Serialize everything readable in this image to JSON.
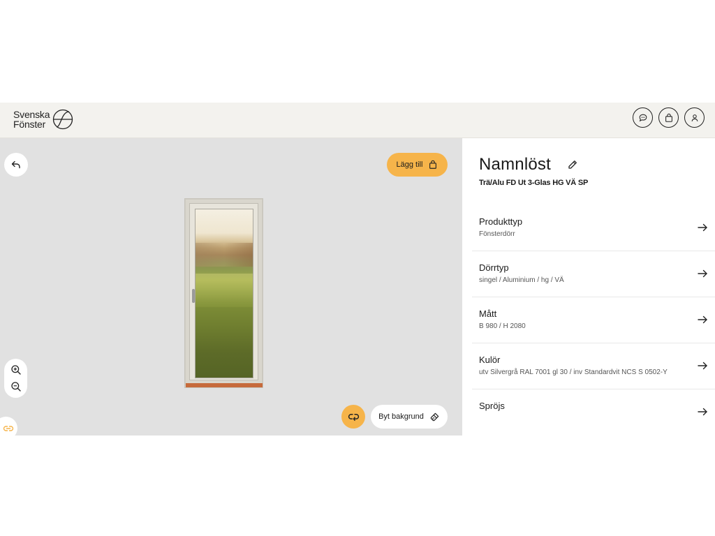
{
  "header": {
    "brand_line1": "Svenska",
    "brand_line2": "Fönster",
    "actions": [
      {
        "icon": "chat-icon"
      },
      {
        "icon": "bag-icon"
      },
      {
        "icon": "user-icon"
      }
    ]
  },
  "canvas": {
    "add_label": "Lägg till",
    "background_label": "Byt bakgrund",
    "accent_color": "#f6b44a",
    "background_color": "#e1e1e1"
  },
  "product": {
    "name": "Namnlöst",
    "subtitle": "Trä/Alu FD Ut 3-Glas HG VÄ SP"
  },
  "options": [
    {
      "title": "Produkttyp",
      "value": "Fönsterdörr"
    },
    {
      "title": "Dörrtyp",
      "value": "singel / Aluminium / hg / VÄ"
    },
    {
      "title": "Mått",
      "value": "B 980 / H 2080"
    },
    {
      "title": "Kulör",
      "value": "utv Silvergrå RAL 7001 gl 30 / inv Standardvit NCS S 0502-Y"
    },
    {
      "title": "Spröjs",
      "value": ""
    }
  ]
}
